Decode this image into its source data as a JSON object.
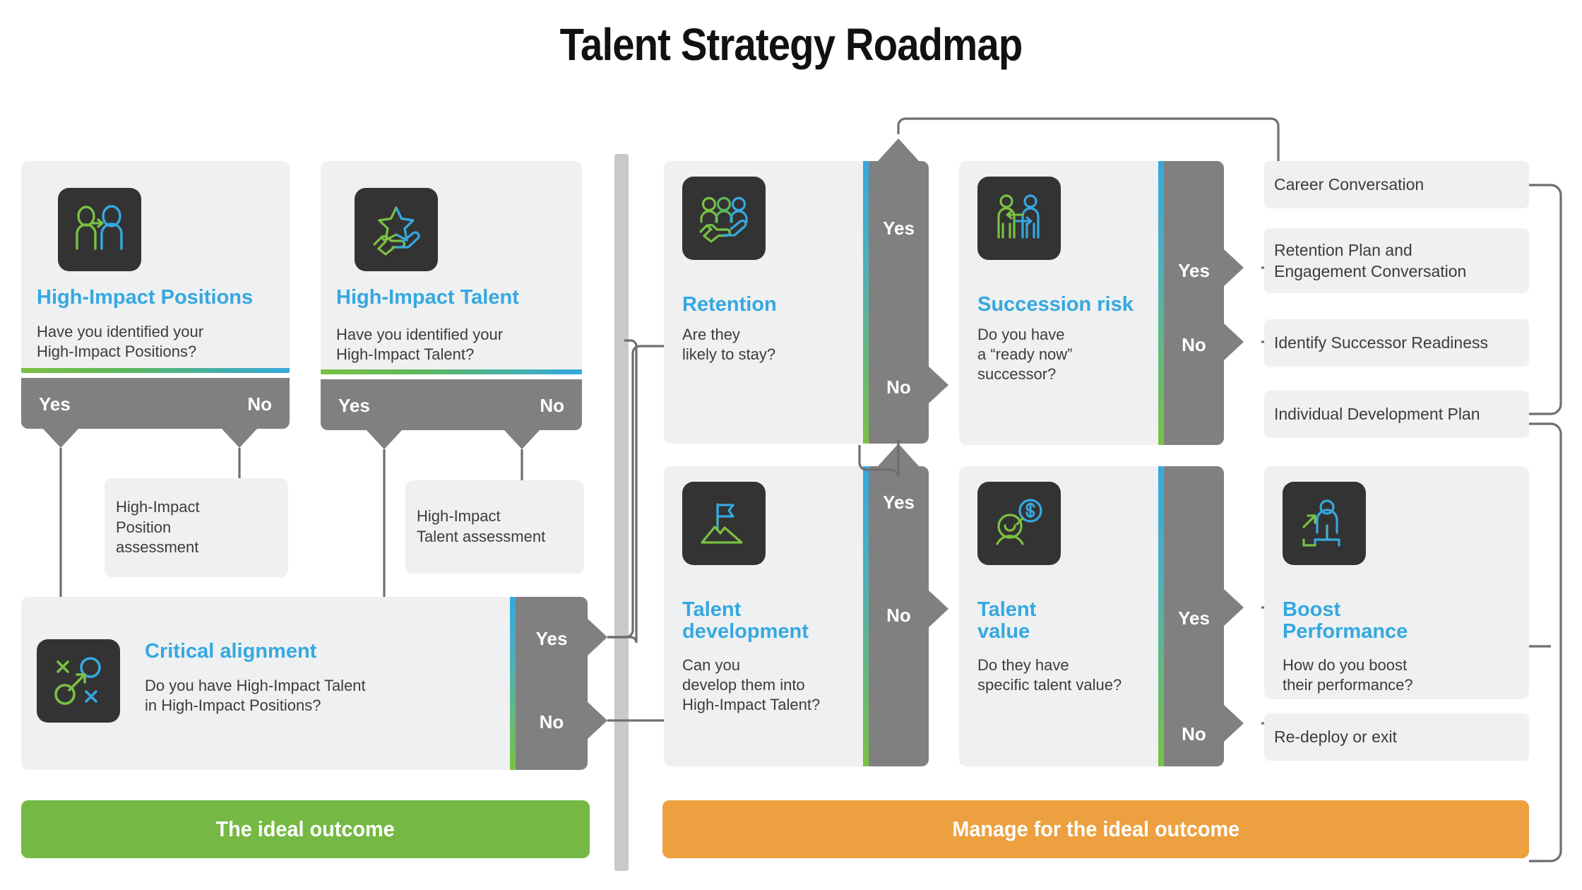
{
  "title": "Talent Strategy Roadmap",
  "colors": {
    "accent_blue": "#35a8e0",
    "accent_green": "#7ac143",
    "gray_panel": "#808080",
    "card_bg": "#eef0f1",
    "icon_tile": "#333333",
    "banner_green": "#75b843",
    "banner_orange": "#eda03f"
  },
  "left_stage": {
    "cards": [
      {
        "icon": "person-transition-icon",
        "title": "High-Impact Positions",
        "question": "Have you identified your\nHigh-Impact Positions?",
        "yes_label": "Yes",
        "no_label": "No",
        "outcome": "High-Impact\nPosition\nassessment"
      },
      {
        "icon": "hand-star-icon",
        "title": "High-Impact Talent",
        "question": "Have you identified your\nHigh-Impact Talent?",
        "yes_label": "Yes",
        "no_label": "No",
        "outcome": "High-Impact\nTalent assessment"
      }
    ],
    "critical": {
      "icon": "x-o-strategy-icon",
      "title": "Critical alignment",
      "question": "Do you have High-Impact Talent\nin High-Impact Positions?",
      "yes_label": "Yes",
      "no_label": "No"
    },
    "banner": "The ideal outcome"
  },
  "right_stage": {
    "cards": [
      {
        "icon": "hand-people-icon",
        "title": "Retention",
        "question": "Are they\nlikely to stay?",
        "yes_label": "Yes",
        "no_label": "No"
      },
      {
        "icon": "succession-people-icon",
        "title": "Succession risk",
        "question": "Do you have\na “ready now”\nsuccessor?",
        "yes_label": "Yes",
        "no_label": "No"
      },
      {
        "icon": "mountain-flag-icon",
        "title": "Talent\ndevelopment",
        "question": "Can you\ndevelop them into\nHigh-Impact Talent?",
        "yes_label": "Yes",
        "no_label": "No"
      },
      {
        "icon": "person-dollar-icon",
        "title": "Talent\nvalue",
        "question": "Do they have\nspecific talent value?",
        "yes_label": "Yes",
        "no_label": "No"
      },
      {
        "icon": "person-growth-icon",
        "title": "Boost\nPerformance",
        "question": "How do you boost\ntheir performance?"
      }
    ],
    "outcomes": [
      "Career Conversation",
      "Retention Plan and\nEngagement Conversation",
      "Identify Successor Readiness",
      "Individual  Development Plan",
      "Re-deploy or exit"
    ],
    "banner": "Manage for the ideal outcome"
  }
}
